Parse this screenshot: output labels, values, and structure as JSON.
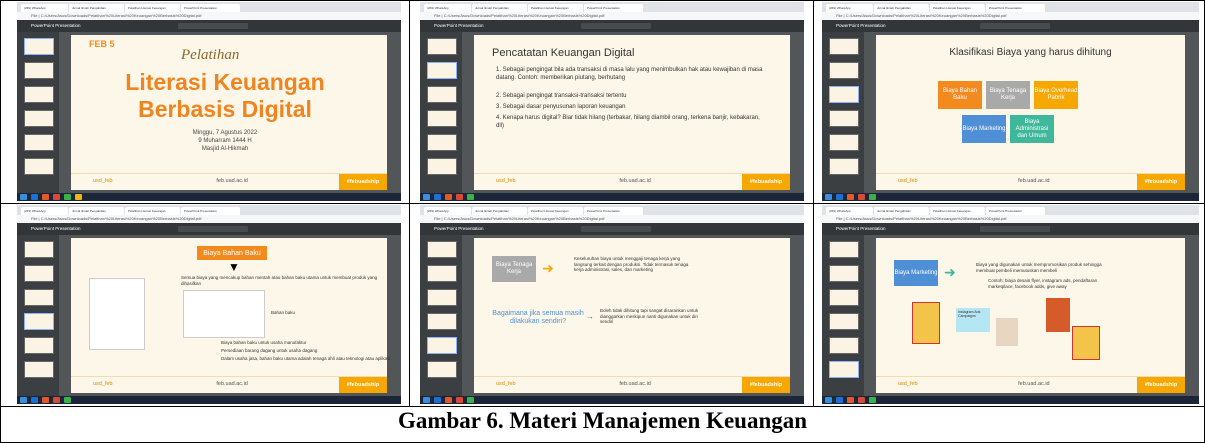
{
  "caption": "Gambar 6. Materi Manajemen Keuangan",
  "common": {
    "address": "File | C:/Users/Asus/Downloads/Pelatihan%20Literasi%20Keuangan%20Berbasis%20Digital.pdf",
    "pdf_title": "PowerPoint Presentation",
    "tab_labels": [
      "(269) WhatsApp",
      "Jurnal Ilmiah Pengabdian",
      "Pelatihan Literasi Keuangan",
      "PowerPoint Presentation"
    ],
    "footer_social": "usd_feb",
    "footer_web": "feb.uad.ac.id",
    "footer_hash": "#febuadship"
  },
  "slide1": {
    "logo_text": "FEB 5",
    "script": "Pelatihan",
    "title_line1": "Literasi Keuangan",
    "title_line2": "Berbasis Digital",
    "date": "Minggu, 7 Agustus 2022",
    "hijri": "9 Muharram 1444 H",
    "venue": "Masjid Al-Hikmah"
  },
  "slide2": {
    "title": "Pencatatan Keuangan Digital",
    "items": [
      "1.  Sebagai pengingat bila ada transaksi di masa lalu yang menimbulkan hak atau kewajiban di masa datang. Contoh: memberikan piutang, berhutang",
      "2.  Sebagai pengingat transaksi-transaksi tertentu",
      "3.  Sebagai dasar penyusunan laporan keuangan",
      "4.  Kenapa harus digital? Biar tidak hilang (terbakar, hilang diambil orang, terkena banjir, kebakaran, dll)"
    ]
  },
  "slide3": {
    "title": "Klasifikasi Biaya yang harus dihitung",
    "boxes": [
      "Biaya Bahan Baku",
      "Biaya Tenaga Kerja",
      "Biaya Overhead Pabrik",
      "Biaya Marketing",
      "Biaya Administrasi dan Umum"
    ]
  },
  "slide4": {
    "banner": "Biaya Bahan Baku",
    "intro": "Semua biaya yang mencakup bahan mentah atau bahan baku utama untuk membuat produk yang dihasilkan",
    "side_label": "Bahan baku",
    "points": [
      "Biaya bahan baku untuk usaha manufaktur",
      "Persediaan barang dagang untuk usaha dagang",
      "Dalam usaha jasa, bahan baku utama adalah tenaga ahli atau teknologi atau aplikasi"
    ]
  },
  "slide5": {
    "label": "Biaya Tenaga Kerja",
    "desc": "Keseluruhan biaya untuk menggaji tenaga kerja yang langsung terkait dengan produksi. Tidak termasuk tenaga kerja administrasi, sales, dan marketing",
    "question": "Bagaimana jika semua masih dilakukan sendiri?",
    "answer": "Boleh tidak dihitung tapi sangat disarankan untuk dianggarkan meskipun nanti digunakan untuk diri sendiri"
  },
  "slide6": {
    "label": "Biaya Marketing",
    "desc": "Biaya yang digunakan untuk mempromosikan produk sehingga membuat pembeli memutuskan membeli",
    "example": "Contoh: biaya desain flyer, instagram ads, pendaftaran marketplace, facebook adds, give away",
    "mini_text": "Instagram Ads Campaigns"
  },
  "colors": {
    "orange": "#f28a1e",
    "grey_box": "#a9a9a9",
    "gold": "#f6a800",
    "blue_box": "#4f8fd6",
    "teal_box": "#3fb79a",
    "title_orange": "#f0841f"
  }
}
